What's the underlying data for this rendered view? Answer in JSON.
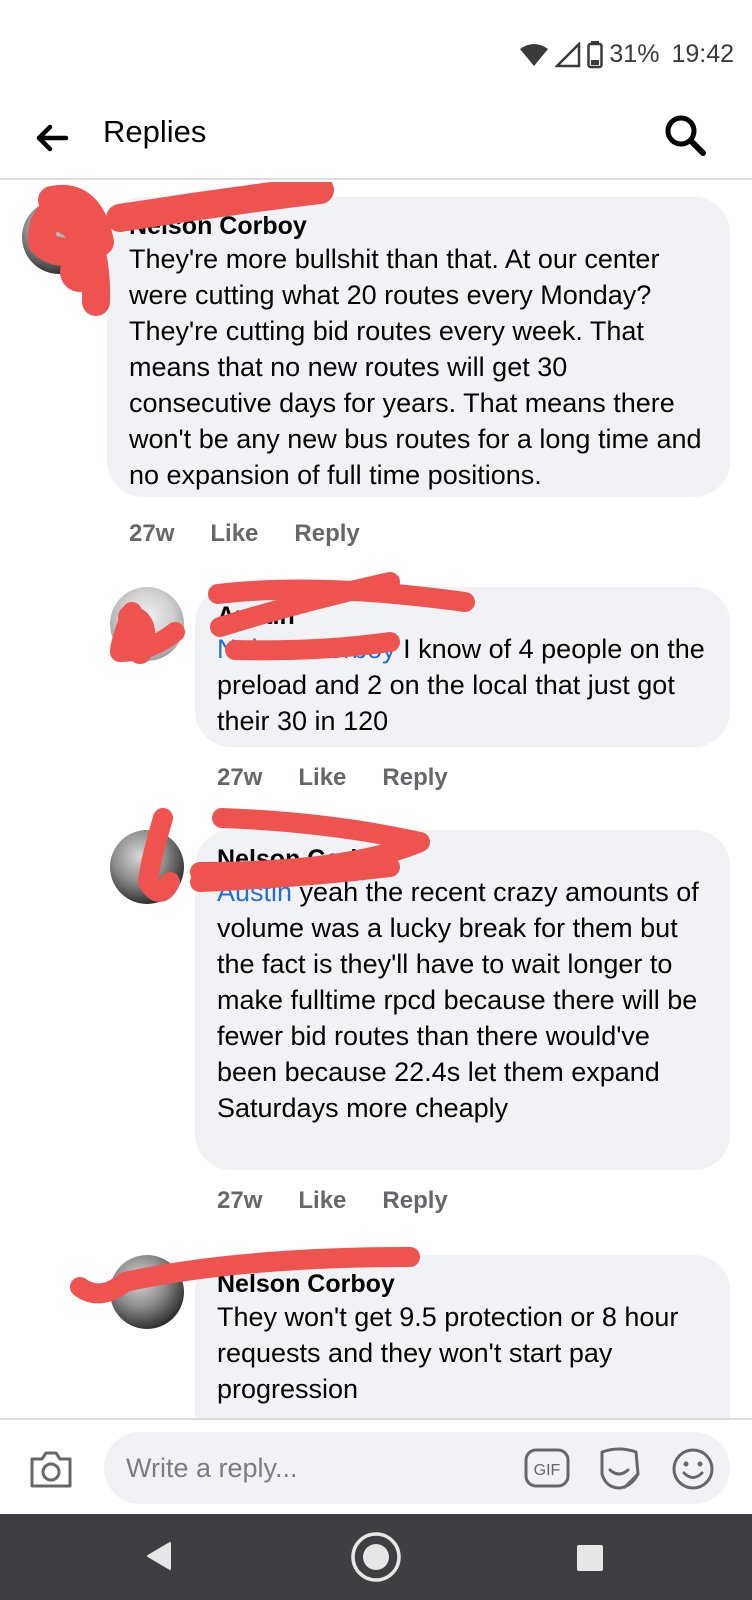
{
  "status_bar": {
    "battery": "31%",
    "time": "19:42"
  },
  "header": {
    "title": "Replies",
    "back_icon": "arrow-left-icon",
    "search_icon": "search-icon"
  },
  "comments": [
    {
      "author": "Nelson Corboy",
      "text": "They're more bullshit than that. At our center were cutting what 20 routes every Monday? They're cutting bid routes every week. That means that no new routes will get 30 consecutive days for years. That means there won't be any new bus routes for a long time and no expansion of full time positions.",
      "time": "27w",
      "like": "Like",
      "reply": "Reply"
    },
    {
      "author": "Austin",
      "mention": "Nelson Corboy",
      "text": " I know of 4 people on the preload and 2 on the local that just got their 30 in 120",
      "time": "27w",
      "like": "Like",
      "reply": "Reply"
    },
    {
      "author": "Nelson Corboy",
      "mention": "Austin",
      "text": " yeah the recent crazy amounts of volume was a lucky break for them but the fact is they'll have to wait longer to make fulltime rpcd because there will be fewer bid routes than there would've been because 22.4s let them expand Saturdays more cheaply",
      "time": "27w",
      "like": "Like",
      "reply": "Reply"
    },
    {
      "author": "Nelson Corboy",
      "text": "They won't get 9.5 protection or 8 hour requests and they won't start pay progression"
    }
  ],
  "composer": {
    "placeholder": "Write a reply...",
    "gif_label": "GIF"
  },
  "colors": {
    "bubble": "#f0f2f5",
    "mention": "#216fdb",
    "meta": "#65676b",
    "redaction": "#ef5350",
    "navbar": "#3d3f42"
  }
}
